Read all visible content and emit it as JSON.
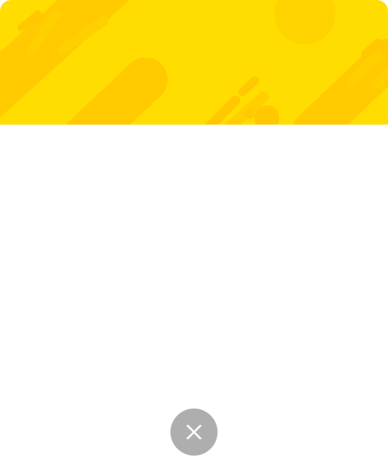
{
  "modal": {
    "banner": {
      "background_color": "#FFDD00",
      "accent_color": "#FFC800",
      "pattern": "diagonal-rounded-stripes"
    },
    "content": {}
  },
  "close_button": {
    "icon": "close-icon",
    "background_color": "#AEAEAE",
    "icon_color": "#FFFFFF"
  }
}
